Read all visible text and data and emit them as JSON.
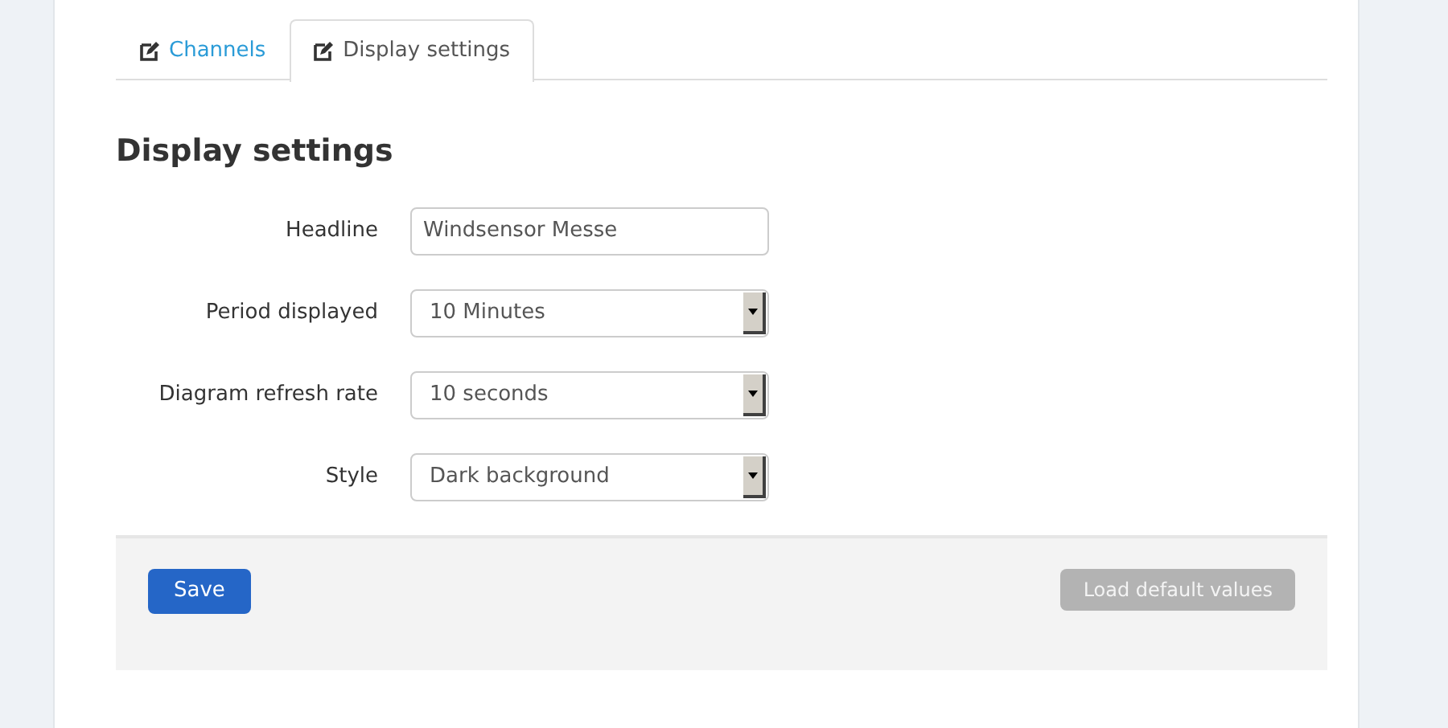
{
  "tabs": [
    {
      "label": "Channels",
      "selected": false
    },
    {
      "label": "Display settings",
      "selected": true
    }
  ],
  "heading": "Display settings",
  "fields": [
    {
      "label": "Headline",
      "kind": "text",
      "value": "Windsensor Messe"
    },
    {
      "label": "Period displayed",
      "kind": "select",
      "value": "10 Minutes"
    },
    {
      "label": "Diagram refresh rate",
      "kind": "select",
      "value": "10 seconds"
    },
    {
      "label": "Style",
      "kind": "select",
      "value": "Dark background"
    }
  ],
  "buttons": [
    {
      "label": "Save",
      "disabled": false
    },
    {
      "label": "Load default values",
      "disabled": true
    }
  ]
}
